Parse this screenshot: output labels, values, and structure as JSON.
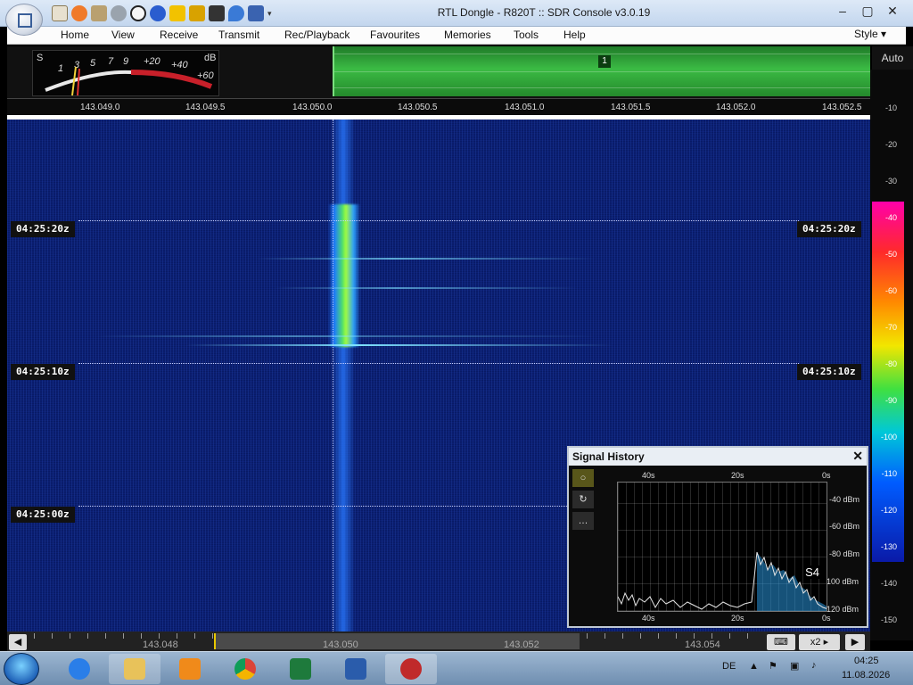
{
  "window": {
    "title": "RTL Dongle - R820T :: SDR Console v3.0.19"
  },
  "menu": {
    "items": [
      "Home",
      "View",
      "Receive",
      "Transmit",
      "Rec/Playback",
      "Favourites",
      "Memories",
      "Tools",
      "Help"
    ],
    "style_label": "Style"
  },
  "smeter": {
    "s_label": "S",
    "db_label": "dB",
    "scale": [
      "1",
      "3",
      "5",
      "7",
      "9",
      "+20",
      "+40",
      "+60"
    ]
  },
  "band": {
    "marker": "1"
  },
  "scale_panel": {
    "auto_label": "Auto",
    "db_values": [
      "-10",
      "-20",
      "-30",
      "-40",
      "-50",
      "-60",
      "-70",
      "-80",
      "-90",
      "-100",
      "-110",
      "-120",
      "-130",
      "-140",
      "-150"
    ]
  },
  "frequency_ruler": {
    "ticks": [
      "143.049.0",
      "143.049.5",
      "143.050.0",
      "143.050.5",
      "143.051.0",
      "143.051.5",
      "143.052.0",
      "143.052.5"
    ]
  },
  "waterfall": {
    "time_markers": [
      "04:25:20z",
      "04:25:10z",
      "04:25:00z"
    ]
  },
  "signal_history": {
    "title": "Signal History",
    "close": "✕",
    "side_buttons": [
      "○",
      "↻",
      "…"
    ],
    "top_axis": [
      "40s",
      "20s",
      "0s"
    ],
    "bottom_axis": [
      "40s",
      "20s",
      "0s"
    ],
    "y_axis": [
      "-40 dBm",
      "-60 dBm",
      "-80 dBm",
      "-100 dBm",
      "-120 dBm"
    ],
    "s_reading": "S4"
  },
  "bottom_ruler": {
    "ticks": [
      "143.048",
      "143.050",
      "143.052",
      "143.054"
    ],
    "zoom_label": "x2"
  },
  "taskbar": {
    "language": "DE",
    "time": "04:25",
    "date": "11.08.2026"
  }
}
